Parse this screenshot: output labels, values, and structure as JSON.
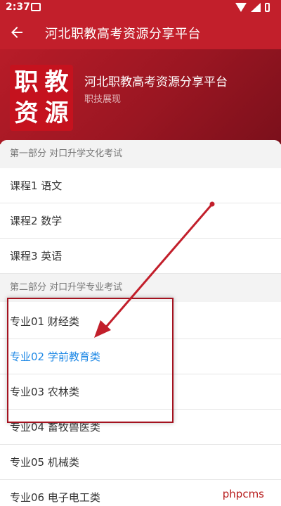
{
  "status_bar": {
    "time": "2:37"
  },
  "app_bar": {
    "title": "河北职教高考资源分享平台"
  },
  "banner": {
    "logo_chars": [
      "职",
      "教",
      "资",
      "源"
    ],
    "title": "河北职教高考资源分享平台",
    "subtitle": "职技展现"
  },
  "sections": [
    {
      "header": "第一部分 对口升学文化考试",
      "items": [
        "课程1 语文",
        "课程2 数学",
        "课程3 英语"
      ]
    },
    {
      "header": "第二部分 对口升学专业考试",
      "items": [
        "专业01 财经类",
        "专业02 学前教育类",
        "专业03 农林类",
        "专业04 畜牧兽医类",
        "专业05 机械类",
        "专业06 电子电工类"
      ]
    }
  ],
  "selected_item": "专业02 学前教育类",
  "colors": {
    "primary": "#c21f2b",
    "selected_text": "#1e88e5",
    "annotation": "#a4121f"
  },
  "watermark": "phpcms"
}
